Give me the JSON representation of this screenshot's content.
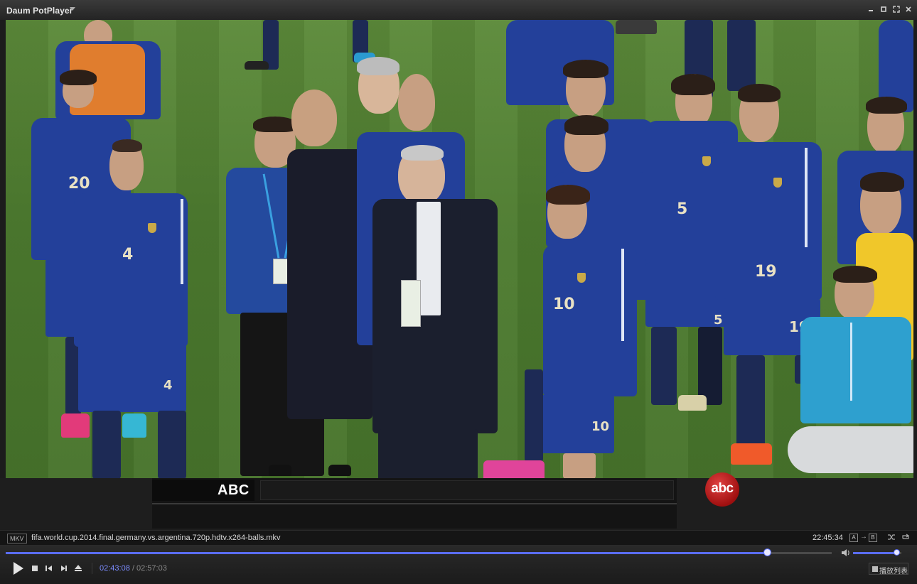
{
  "window": {
    "title": "Daum PotPlayer"
  },
  "video": {
    "caption_bar": {
      "channel_label": "ABC",
      "logo_text": "abc"
    },
    "jersey_numbers": [
      "20",
      "4",
      "5",
      "19",
      "10",
      "5",
      "19",
      "4",
      "10"
    ]
  },
  "infobar": {
    "container": "MKV",
    "filename": "fifa.world.cup.2014.final.germany.vs.argentina.720p.hdtv.x264-balls.mkv",
    "clock": "22:45:34",
    "repeat_a": "A",
    "repeat_b": "B",
    "ab_arrow": "→"
  },
  "controls": {
    "time_current": "02:43:08",
    "time_separator": "/",
    "time_total": "02:57:03",
    "progress_fraction": 0.9218,
    "volume_fraction": 0.91,
    "playlist_label": "播放列表",
    "icons": [
      "play-icon",
      "stop-icon",
      "previous-icon",
      "next-icon",
      "eject-icon",
      "volume-icon",
      "shuffle-icon",
      "loop-icon"
    ]
  },
  "colors": {
    "accent": "#5a6df2",
    "pitch": "#4d7b2f",
    "jersey": "#23409a",
    "abc_logo": "#c01818"
  }
}
